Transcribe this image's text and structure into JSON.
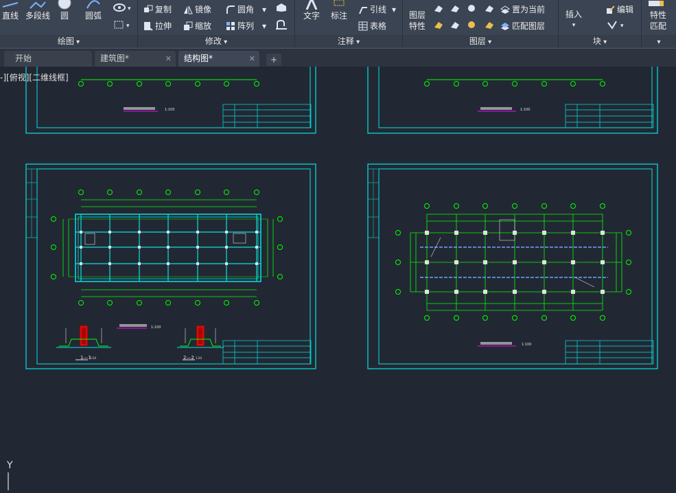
{
  "ribbon": {
    "draw": {
      "title": "绘图",
      "line": "直线",
      "polyline": "多段线",
      "circle": "圆",
      "arc": "圆弧"
    },
    "modify": {
      "title": "修改",
      "copy": "复制",
      "mirror": "镜像",
      "fillet": "圆角",
      "stretch": "拉伸",
      "scale": "缩放",
      "array": "阵列"
    },
    "annotation": {
      "title": "注释",
      "text": "文字",
      "dimension": "标注",
      "leader": "引线",
      "table": "表格"
    },
    "layers": {
      "title": "图层",
      "properties_line1": "图层",
      "properties_line2": "特性",
      "set_current": "置为当前",
      "match_layer": "匹配图层"
    },
    "block": {
      "title": "块",
      "insert": "插入",
      "edit": "编辑"
    },
    "properties": {
      "match_line1": "特性",
      "match_line2": "匹配"
    }
  },
  "tabs": [
    {
      "label": "开始"
    },
    {
      "label": "建筑图*"
    },
    {
      "label": "结构图*"
    }
  ],
  "viewport_label": "-][俯视][二维线框]",
  "ucs_axis_label": "Y",
  "sheets": {
    "top_left_scale": "1:100",
    "top_right_scale": "1:100",
    "bottom_left_scale": "1:100",
    "bottom_right_scale": "1:100",
    "section_1": "1—1",
    "section_2": "2—2",
    "section_scale": "1:20"
  },
  "colors": {
    "cad_background": "#222833",
    "frame_cyan": "#00e5e5",
    "grid_green": "#00ff00",
    "title_magenta": "#ff00ff",
    "ribbon_bg": "#3b4453",
    "dark_red": "#b00000"
  }
}
